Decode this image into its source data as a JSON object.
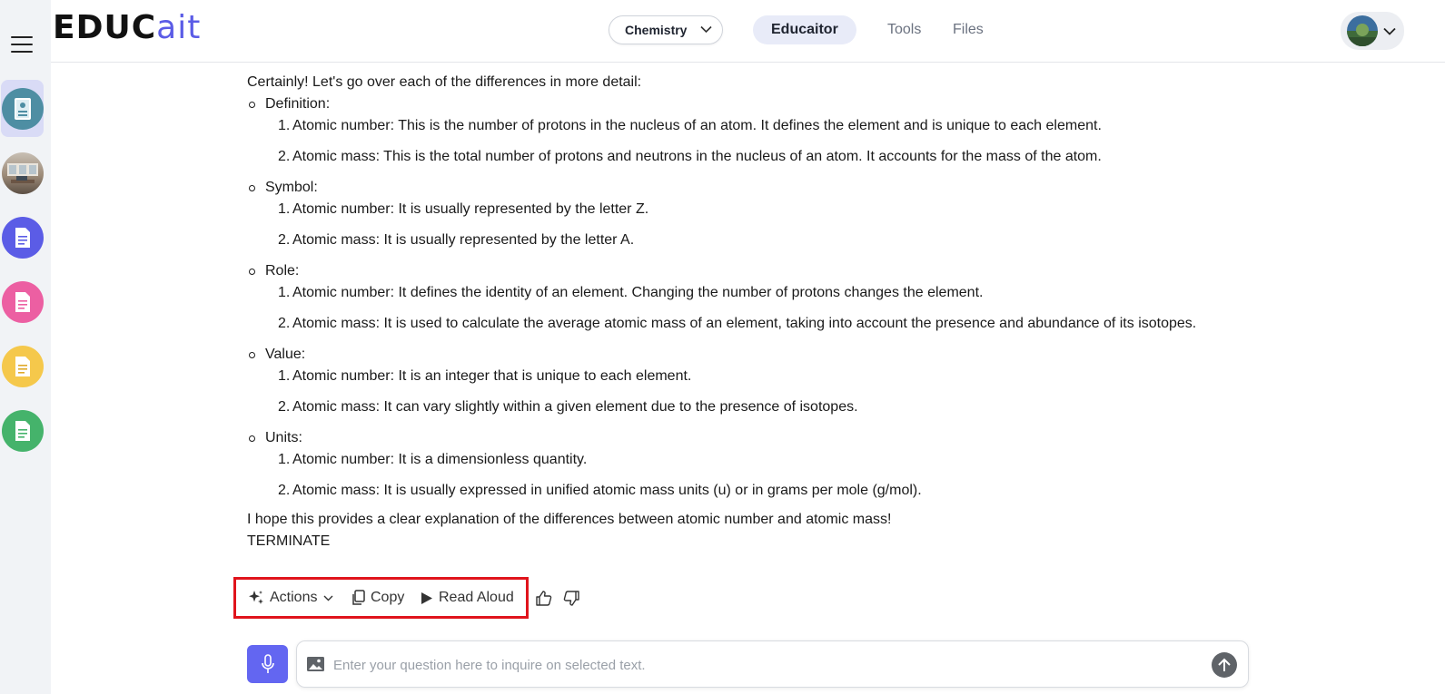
{
  "app": {
    "logo_main": "EDUC",
    "logo_accent": "ait"
  },
  "header": {
    "subject": "Chemistry",
    "tabs": [
      {
        "label": "Educaitor",
        "active": true
      },
      {
        "label": "Tools",
        "active": false
      },
      {
        "label": "Files",
        "active": false
      }
    ]
  },
  "sidebar": {
    "items": [
      {
        "icon": "document-icon",
        "color": "#4e8ea3",
        "active": true
      },
      {
        "icon": "classroom-photo",
        "color": "#8a7868",
        "active": false
      },
      {
        "icon": "document-icon",
        "color": "#5b5ce6",
        "active": false
      },
      {
        "icon": "document-icon",
        "color": "#ec5fa2",
        "active": false
      },
      {
        "icon": "document-icon",
        "color": "#f5c84b",
        "active": false
      },
      {
        "icon": "document-icon",
        "color": "#45b36b",
        "active": false
      }
    ]
  },
  "message": {
    "intro": "Certainly! Let's go over each of the differences in more detail:",
    "sections": [
      {
        "title": "Definition:",
        "items": [
          "Atomic number: This is the number of protons in the nucleus of an atom. It defines the element and is unique to each element.",
          "Atomic mass: This is the total number of protons and neutrons in the nucleus of an atom. It accounts for the mass of the atom."
        ]
      },
      {
        "title": "Symbol:",
        "items": [
          "Atomic number: It is usually represented by the letter Z.",
          "Atomic mass: It is usually represented by the letter A."
        ]
      },
      {
        "title": "Role:",
        "items": [
          "Atomic number: It defines the identity of an element. Changing the number of protons changes the element.",
          "Atomic mass: It is used to calculate the average atomic mass of an element, taking into account the presence and abundance of its isotopes."
        ]
      },
      {
        "title": "Value:",
        "items": [
          "Atomic number: It is an integer that is unique to each element.",
          "Atomic mass: It can vary slightly within a given element due to the presence of isotopes."
        ]
      },
      {
        "title": "Units:",
        "items": [
          "Atomic number: It is a dimensionless quantity.",
          "Atomic mass: It is usually expressed in unified atomic mass units (u) or in grams per mole (g/mol)."
        ]
      }
    ],
    "closing": "I hope this provides a clear explanation of the differences between atomic number and atomic mass!",
    "terminate": "TERMINATE"
  },
  "toolbar": {
    "actions_label": "Actions",
    "copy_label": "Copy",
    "read_aloud_label": "Read Aloud"
  },
  "composer": {
    "placeholder": "Enter your question here to inquire on selected text."
  },
  "colors": {
    "accent": "#6366f1",
    "highlight_box": "#e0141c"
  }
}
